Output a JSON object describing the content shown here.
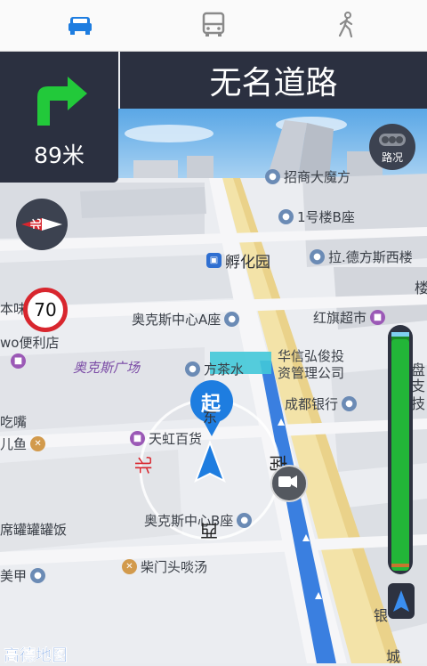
{
  "modes": {
    "car": {
      "icon": "car-icon",
      "color": "#1e7de0"
    },
    "bus": {
      "icon": "bus-icon",
      "color": "#888888"
    },
    "walk": {
      "icon": "walk-icon",
      "color": "#888888"
    }
  },
  "guidance": {
    "turn_icon": "turn-right-arrow-icon",
    "distance": "89米",
    "road_name": "无名道路"
  },
  "traffic_button": {
    "label": "路况",
    "icon": "traffic-light-icon"
  },
  "compass": {
    "label": "北"
  },
  "speed_limit": "70",
  "poi": {
    "zhaoshang": "招商大魔方",
    "building1b": "1号楼B座",
    "fuhuayuan": "孵化园",
    "ladefang": "拉.德方斯西楼",
    "aoke_a": "奥克斯中心A座",
    "hongqi": "红旗超市",
    "ben_wei": "本味",
    "wo_store": "wo便利店",
    "aoke_plaza": "奥克斯广场",
    "fangcha": "方茶水",
    "huaxin": "华信弘俊投",
    "zichan": "资管理公司",
    "chengdu_bank": "成都银行",
    "tianhong": "天虹百货",
    "chizui": "吃嘴",
    "er_yu": "儿鱼",
    "aoke_b": "奥克斯中心B座",
    "xiwei": "席罐罐罐饭",
    "meijia": "美甲",
    "chaimen": "柴门头啖汤",
    "right_pan": "盘",
    "right_zhi": "支",
    "right_zhi2": "技",
    "right_ji": "楼",
    "right_ban": "银",
    "right_cheng": "城"
  },
  "map_labels": {
    "start_label": "起",
    "east": "东",
    "south": "南",
    "west": "西",
    "north_marker": "北"
  },
  "route_progress_fraction": 0.97,
  "brand": "高德地图",
  "colors": {
    "panel": "#2b3040",
    "route": "#3a7fe0",
    "accent_green": "#22c93a",
    "speed_ring": "#d8262e"
  }
}
